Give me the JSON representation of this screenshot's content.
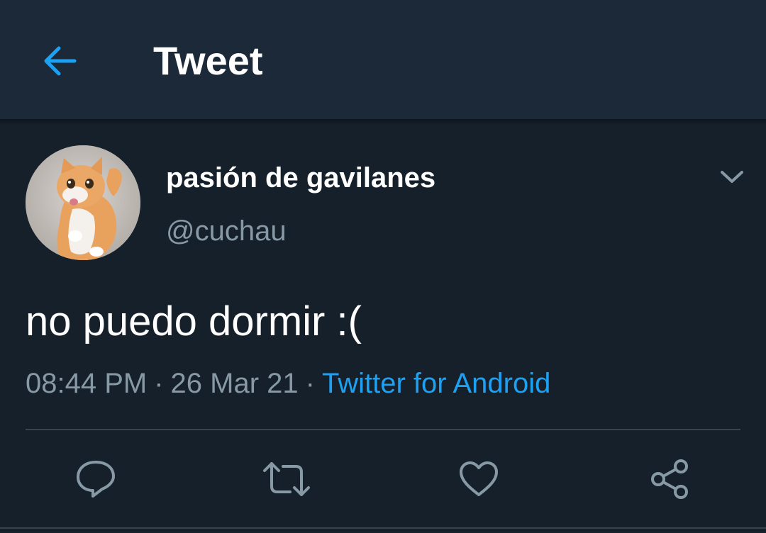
{
  "header": {
    "title": "Tweet",
    "back_icon": "arrow-left-icon"
  },
  "tweet": {
    "display_name": "pasión de gavilanes",
    "handle": "@cuchau",
    "text": "no puedo dormir :(",
    "time": "08:44 PM",
    "date": "26 Mar 21",
    "separator": "·",
    "source": "Twitter for Android"
  },
  "actions": [
    {
      "icon": "reply-icon"
    },
    {
      "icon": "retweet-icon"
    },
    {
      "icon": "like-icon"
    },
    {
      "icon": "share-icon"
    }
  ],
  "colors": {
    "background": "#15202b",
    "header": "#1c2938",
    "accent": "#1da1f2",
    "secondary_text": "#8899a6",
    "divider": "#38444d"
  }
}
